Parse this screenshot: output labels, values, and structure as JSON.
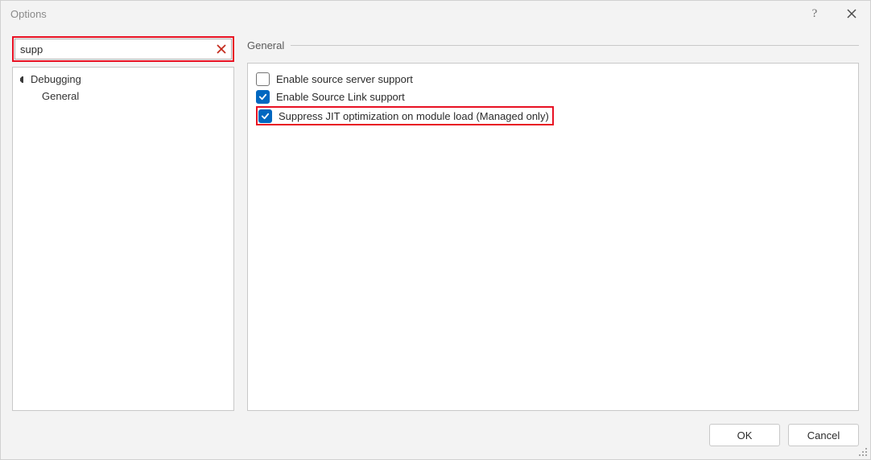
{
  "title": "Options",
  "search": {
    "value": "supp"
  },
  "tree": {
    "items": [
      {
        "label": "Debugging",
        "children": [
          {
            "label": "General"
          }
        ]
      }
    ]
  },
  "group": {
    "title": "General"
  },
  "options": [
    {
      "label": "Enable source server support",
      "checked": false
    },
    {
      "label": "Enable Source Link support",
      "checked": true
    },
    {
      "label": "Suppress JIT optimization on module load (Managed only)",
      "checked": true,
      "highlighted": true
    }
  ],
  "buttons": {
    "ok": "OK",
    "cancel": "Cancel"
  },
  "help_icon": "?"
}
